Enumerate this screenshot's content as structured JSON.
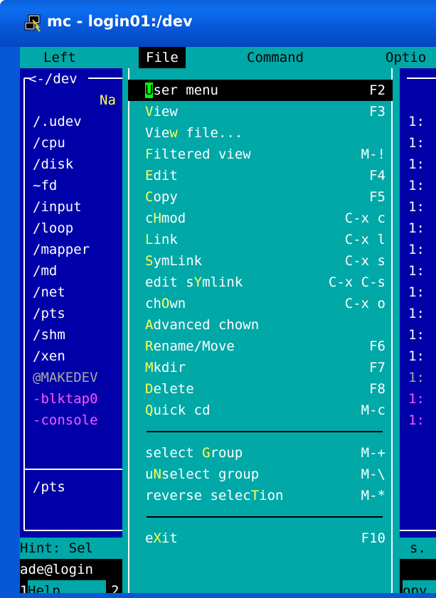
{
  "window": {
    "title": "mc - login01:/dev",
    "icon": "putty-terminal-icon"
  },
  "menubar": {
    "items": [
      "Left",
      "File",
      "Command",
      "Options"
    ],
    "visible": [
      "Left",
      "File",
      "Command",
      "Optio"
    ],
    "selected": "File"
  },
  "left_panel": {
    "path_header": "<-/dev",
    "column_header": "Na",
    "entries": [
      "/.udev",
      "/cpu",
      "/disk",
      "~fd",
      "/input",
      "/loop",
      "/mapper",
      "/md",
      "/net",
      "/pts",
      "/shm",
      "/xen",
      "@MAKEDEV",
      "-blktap0",
      "-console"
    ],
    "mini_status": "/pts"
  },
  "right_panel": {
    "column_visible": [
      "1:",
      "1:",
      "1:",
      "1:",
      "1:",
      "1:",
      "1:",
      "1:",
      "1:",
      "1:",
      "1:",
      "1:",
      "1:",
      "1:",
      "1:"
    ]
  },
  "file_menu": {
    "items": [
      {
        "pre": "",
        "hot": "U",
        "post": "ser menu",
        "key": "F2",
        "active": true
      },
      {
        "pre": "",
        "hot": "V",
        "post": "iew",
        "key": "F3"
      },
      {
        "pre": "Vie",
        "hot": "w",
        "post": " file...",
        "key": ""
      },
      {
        "pre": "",
        "hot": "F",
        "post": "iltered view",
        "key": "M-!"
      },
      {
        "pre": "",
        "hot": "E",
        "post": "dit",
        "key": "F4"
      },
      {
        "pre": "",
        "hot": "C",
        "post": "opy",
        "key": "F5"
      },
      {
        "pre": "c",
        "hot": "H",
        "post": "mod",
        "key": "C-x c"
      },
      {
        "pre": "",
        "hot": "L",
        "post": "ink",
        "key": "C-x l"
      },
      {
        "pre": "",
        "hot": "S",
        "post": "ymLink",
        "key": "C-x s"
      },
      {
        "pre": "edit s",
        "hot": "Y",
        "post": "mlink",
        "key": "C-x C-s"
      },
      {
        "pre": "ch",
        "hot": "O",
        "post": "wn",
        "key": "C-x o"
      },
      {
        "pre": "",
        "hot": "A",
        "post": "dvanced chown",
        "key": ""
      },
      {
        "pre": "",
        "hot": "R",
        "post": "ename/Move",
        "key": "F6"
      },
      {
        "pre": "",
        "hot": "M",
        "post": "kdir",
        "key": "F7"
      },
      {
        "pre": "",
        "hot": "D",
        "post": "elete",
        "key": "F8"
      },
      {
        "pre": "",
        "hot": "Q",
        "post": "uick cd",
        "key": "M-c"
      },
      {
        "separator": true
      },
      {
        "pre": "select ",
        "hot": "G",
        "post": "roup",
        "key": "M-+"
      },
      {
        "pre": "u",
        "hot": "N",
        "post": "select group",
        "key": "M-\\"
      },
      {
        "pre": "reverse selec",
        "hot": "T",
        "post": "ion",
        "key": "M-*"
      },
      {
        "separator": true
      },
      {
        "pre": "e",
        "hot": "X",
        "post": "it",
        "key": "F10"
      }
    ]
  },
  "hint_line": "Hint: Sel",
  "hint_right": "s.",
  "command_line": "ade@login",
  "fkeys": [
    {
      "num": "1",
      "label": "Help"
    },
    {
      "num": "2",
      "label": ""
    }
  ],
  "fkey_right": "opy",
  "colors": {
    "panel_bg": "#0000a8",
    "menu_bg": "#00a8a8",
    "hotkey": "#ffff55",
    "active_hotkey_bg": "#00ff00",
    "titlebar": "#0757d6"
  }
}
